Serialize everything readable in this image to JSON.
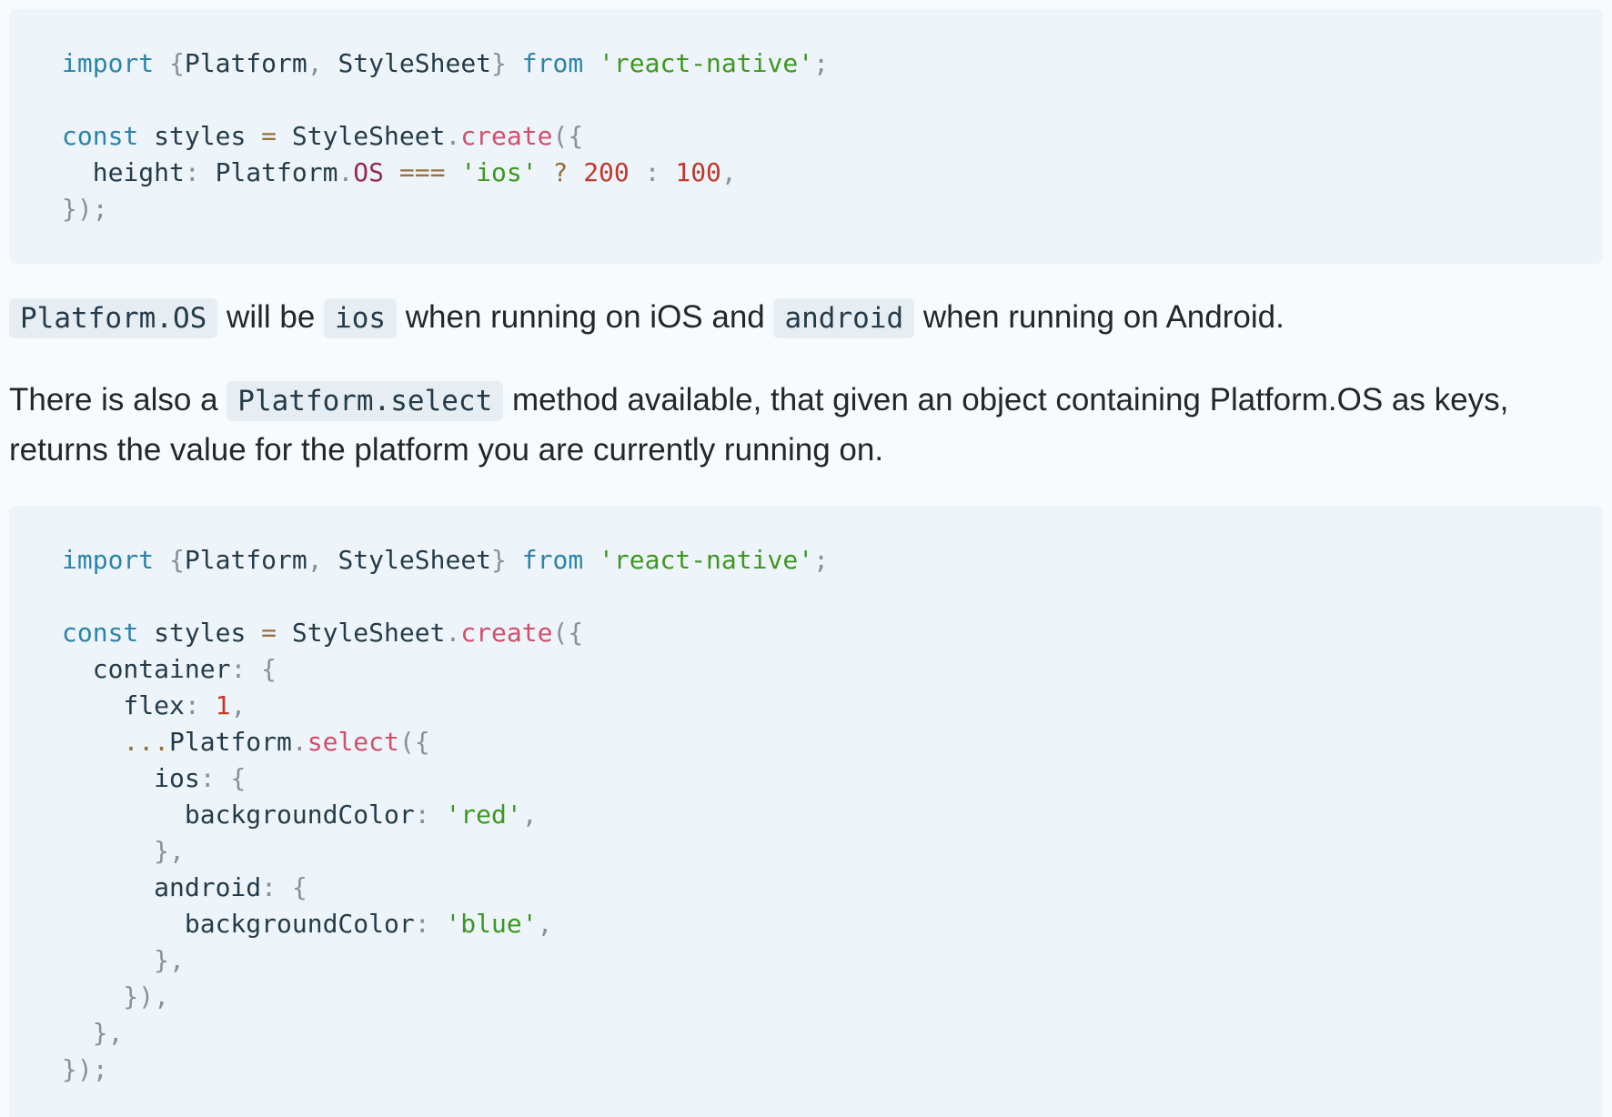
{
  "code_block_1": {
    "lines": [
      [
        {
          "c": "kw",
          "t": "import"
        },
        {
          "c": "pun",
          "t": " {"
        },
        {
          "c": "pl",
          "t": "Platform"
        },
        {
          "c": "pun",
          "t": ", "
        },
        {
          "c": "pl",
          "t": "StyleSheet"
        },
        {
          "c": "pun",
          "t": "} "
        },
        {
          "c": "kw",
          "t": "from"
        },
        {
          "c": "pl",
          "t": " "
        },
        {
          "c": "str",
          "t": "'react-native'"
        },
        {
          "c": "pun",
          "t": ";"
        }
      ],
      [],
      [
        {
          "c": "kw",
          "t": "const"
        },
        {
          "c": "pl",
          "t": " styles "
        },
        {
          "c": "op",
          "t": "="
        },
        {
          "c": "pl",
          "t": " StyleSheet"
        },
        {
          "c": "pun",
          "t": "."
        },
        {
          "c": "fn",
          "t": "create"
        },
        {
          "c": "pun",
          "t": "({"
        }
      ],
      [
        {
          "c": "pl",
          "t": "  height"
        },
        {
          "c": "pun",
          "t": ":"
        },
        {
          "c": "pl",
          "t": " Platform"
        },
        {
          "c": "pun",
          "t": "."
        },
        {
          "c": "prop",
          "t": "OS"
        },
        {
          "c": "pl",
          "t": " "
        },
        {
          "c": "op",
          "t": "==="
        },
        {
          "c": "pl",
          "t": " "
        },
        {
          "c": "str",
          "t": "'ios'"
        },
        {
          "c": "pl",
          "t": " "
        },
        {
          "c": "op",
          "t": "?"
        },
        {
          "c": "pl",
          "t": " "
        },
        {
          "c": "num",
          "t": "200"
        },
        {
          "c": "pl",
          "t": " "
        },
        {
          "c": "pun",
          "t": ":"
        },
        {
          "c": "pl",
          "t": " "
        },
        {
          "c": "num",
          "t": "100"
        },
        {
          "c": "pun",
          "t": ","
        }
      ],
      [
        {
          "c": "pun",
          "t": "});"
        }
      ]
    ]
  },
  "paragraph_1": {
    "code_os": "Platform.OS",
    "text_1": " will be ",
    "code_ios": "ios",
    "text_2": " when running on iOS and ",
    "code_android": "android",
    "text_3": " when running on Android."
  },
  "paragraph_2": {
    "text_1": "There is also a ",
    "code_select": "Platform.select",
    "text_2": " method available, that given an object containing Platform.OS as keys, returns the value for the platform you are currently running on."
  },
  "code_block_2": {
    "lines": [
      [
        {
          "c": "kw",
          "t": "import"
        },
        {
          "c": "pun",
          "t": " {"
        },
        {
          "c": "pl",
          "t": "Platform"
        },
        {
          "c": "pun",
          "t": ", "
        },
        {
          "c": "pl",
          "t": "StyleSheet"
        },
        {
          "c": "pun",
          "t": "} "
        },
        {
          "c": "kw",
          "t": "from"
        },
        {
          "c": "pl",
          "t": " "
        },
        {
          "c": "str",
          "t": "'react-native'"
        },
        {
          "c": "pun",
          "t": ";"
        }
      ],
      [],
      [
        {
          "c": "kw",
          "t": "const"
        },
        {
          "c": "pl",
          "t": " styles "
        },
        {
          "c": "op",
          "t": "="
        },
        {
          "c": "pl",
          "t": " StyleSheet"
        },
        {
          "c": "pun",
          "t": "."
        },
        {
          "c": "fn",
          "t": "create"
        },
        {
          "c": "pun",
          "t": "({"
        }
      ],
      [
        {
          "c": "pl",
          "t": "  container"
        },
        {
          "c": "pun",
          "t": ": {"
        }
      ],
      [
        {
          "c": "pl",
          "t": "    flex"
        },
        {
          "c": "pun",
          "t": ": "
        },
        {
          "c": "num",
          "t": "1"
        },
        {
          "c": "pun",
          "t": ","
        }
      ],
      [
        {
          "c": "pl",
          "t": "    "
        },
        {
          "c": "op",
          "t": "..."
        },
        {
          "c": "pl",
          "t": "Platform"
        },
        {
          "c": "pun",
          "t": "."
        },
        {
          "c": "fn",
          "t": "select"
        },
        {
          "c": "pun",
          "t": "({"
        }
      ],
      [
        {
          "c": "pl",
          "t": "      ios"
        },
        {
          "c": "pun",
          "t": ": {"
        }
      ],
      [
        {
          "c": "pl",
          "t": "        backgroundColor"
        },
        {
          "c": "pun",
          "t": ": "
        },
        {
          "c": "str",
          "t": "'red'"
        },
        {
          "c": "pun",
          "t": ","
        }
      ],
      [
        {
          "c": "pun",
          "t": "      },"
        }
      ],
      [
        {
          "c": "pl",
          "t": "      android"
        },
        {
          "c": "pun",
          "t": ": {"
        }
      ],
      [
        {
          "c": "pl",
          "t": "        backgroundColor"
        },
        {
          "c": "pun",
          "t": ": "
        },
        {
          "c": "str",
          "t": "'blue'"
        },
        {
          "c": "pun",
          "t": ","
        }
      ],
      [
        {
          "c": "pun",
          "t": "      },"
        }
      ],
      [
        {
          "c": "pun",
          "t": "    }),"
        }
      ],
      [
        {
          "c": "pun",
          "t": "  },"
        }
      ],
      [
        {
          "c": "pun",
          "t": "});"
        }
      ]
    ]
  }
}
